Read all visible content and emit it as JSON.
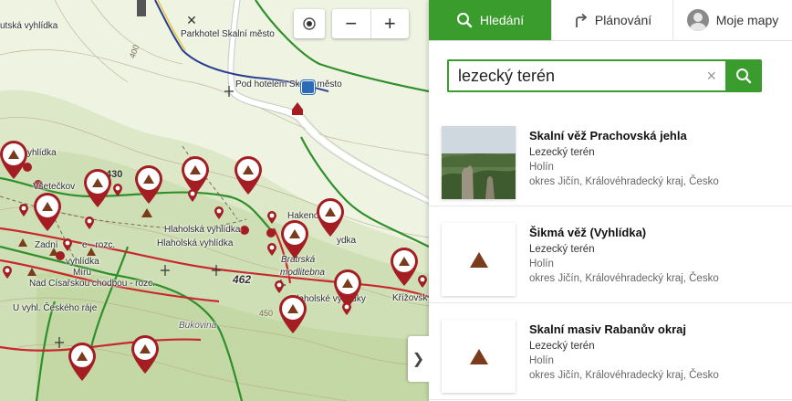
{
  "map": {
    "labels": [
      {
        "id": "parkhotel",
        "text": "Parkhotel Skalní město"
      },
      {
        "id": "pod-hotelem",
        "text": "Pod hotelem Skalní město"
      },
      {
        "id": "vyhlidka-top",
        "text": "utská vyhlídka"
      },
      {
        "id": "vyhlidka-left",
        "text": "yhlídka"
      },
      {
        "id": "vsetecko",
        "text": "Všetečkov"
      },
      {
        "id": "hlahol1",
        "text": "Hlaholská vyhlídka"
      },
      {
        "id": "hlahol2",
        "text": "Hlaholská vyhlídka"
      },
      {
        "id": "hakeno",
        "text": "Hakenov"
      },
      {
        "id": "vyhlidka-mid",
        "text": "ydka"
      },
      {
        "id": "bratrska",
        "text": "Bratrská"
      },
      {
        "id": "modlitebna",
        "text": "modlitebna"
      },
      {
        "id": "zadni",
        "text": "Zadní"
      },
      {
        "id": "rozc",
        "text": "e - rozc."
      },
      {
        "id": "vyhlidka-small",
        "text": "vyhlídka"
      },
      {
        "id": "miru",
        "text": "Míru"
      },
      {
        "id": "cisarska",
        "text": "Nad Císařskou chodbou - rozc."
      },
      {
        "id": "ceskeho",
        "text": "U vyhl. Českého ráje"
      },
      {
        "id": "hlaholske-vyhl",
        "text": "Hlaholské vyhlídky"
      },
      {
        "id": "krizovsk",
        "text": "Křížovsk"
      },
      {
        "id": "bukovina",
        "text": "Bukovina"
      },
      {
        "id": "c462",
        "text": "462"
      },
      {
        "id": "c450",
        "text": "450"
      },
      {
        "id": "c400",
        "text": "400"
      },
      {
        "id": "c430",
        "text": "430"
      }
    ],
    "zoom_in_label": "+",
    "zoom_out_label": "−",
    "collapse_label": "❯"
  },
  "tabs": [
    {
      "label": "Hledání",
      "icon": "search-icon"
    },
    {
      "label": "Plánování",
      "icon": "route-icon"
    },
    {
      "label": "Moje mapy",
      "icon": "avatar"
    }
  ],
  "search": {
    "value": "lezecký terén",
    "clear_label": "×"
  },
  "results": [
    {
      "title": "Skalní věž Prachovská jehla",
      "category": "Lezecký terén",
      "locality": "Holín",
      "region": "okres Jičín, Královéhradecký kraj, Česko",
      "thumb": "photo"
    },
    {
      "title": "Šikmá věž (Vyhlídka)",
      "category": "Lezecký terén",
      "locality": "Holín",
      "region": "okres Jičín, Královéhradecký kraj, Česko",
      "thumb": "climbing-icon"
    },
    {
      "title": "Skalní masiv Rabanův okraj",
      "category": "Lezecký terén",
      "locality": "Holín",
      "region": "okres Jičín, Královéhradecký kraj, Česko",
      "thumb": "climbing-icon"
    }
  ],
  "colors": {
    "accent": "#3a9c2c",
    "pin": "#a31d22",
    "trail_red": "#c8282d",
    "trail_green": "#2f8f2a",
    "trail_blue": "#2a3f8f",
    "climb_icon": "#7a3a1c"
  }
}
